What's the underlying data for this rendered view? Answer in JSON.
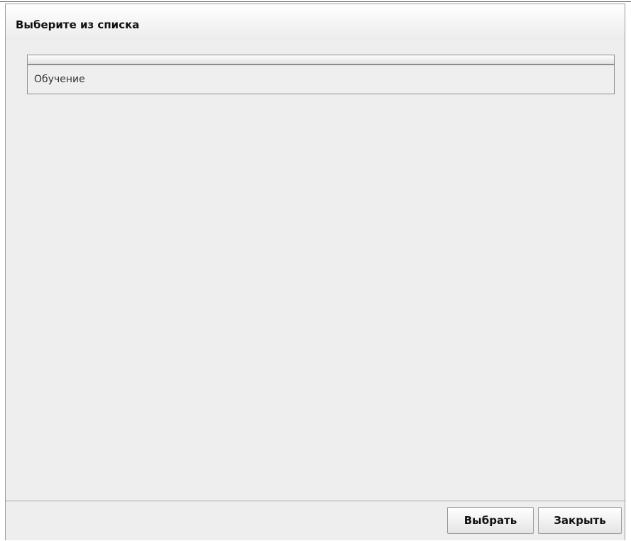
{
  "dialog": {
    "title": "Выберите из списка"
  },
  "list": {
    "items": [
      {
        "label": "Обучение"
      }
    ]
  },
  "footer": {
    "select_label": "Выбрать",
    "close_label": "Закрыть"
  }
}
